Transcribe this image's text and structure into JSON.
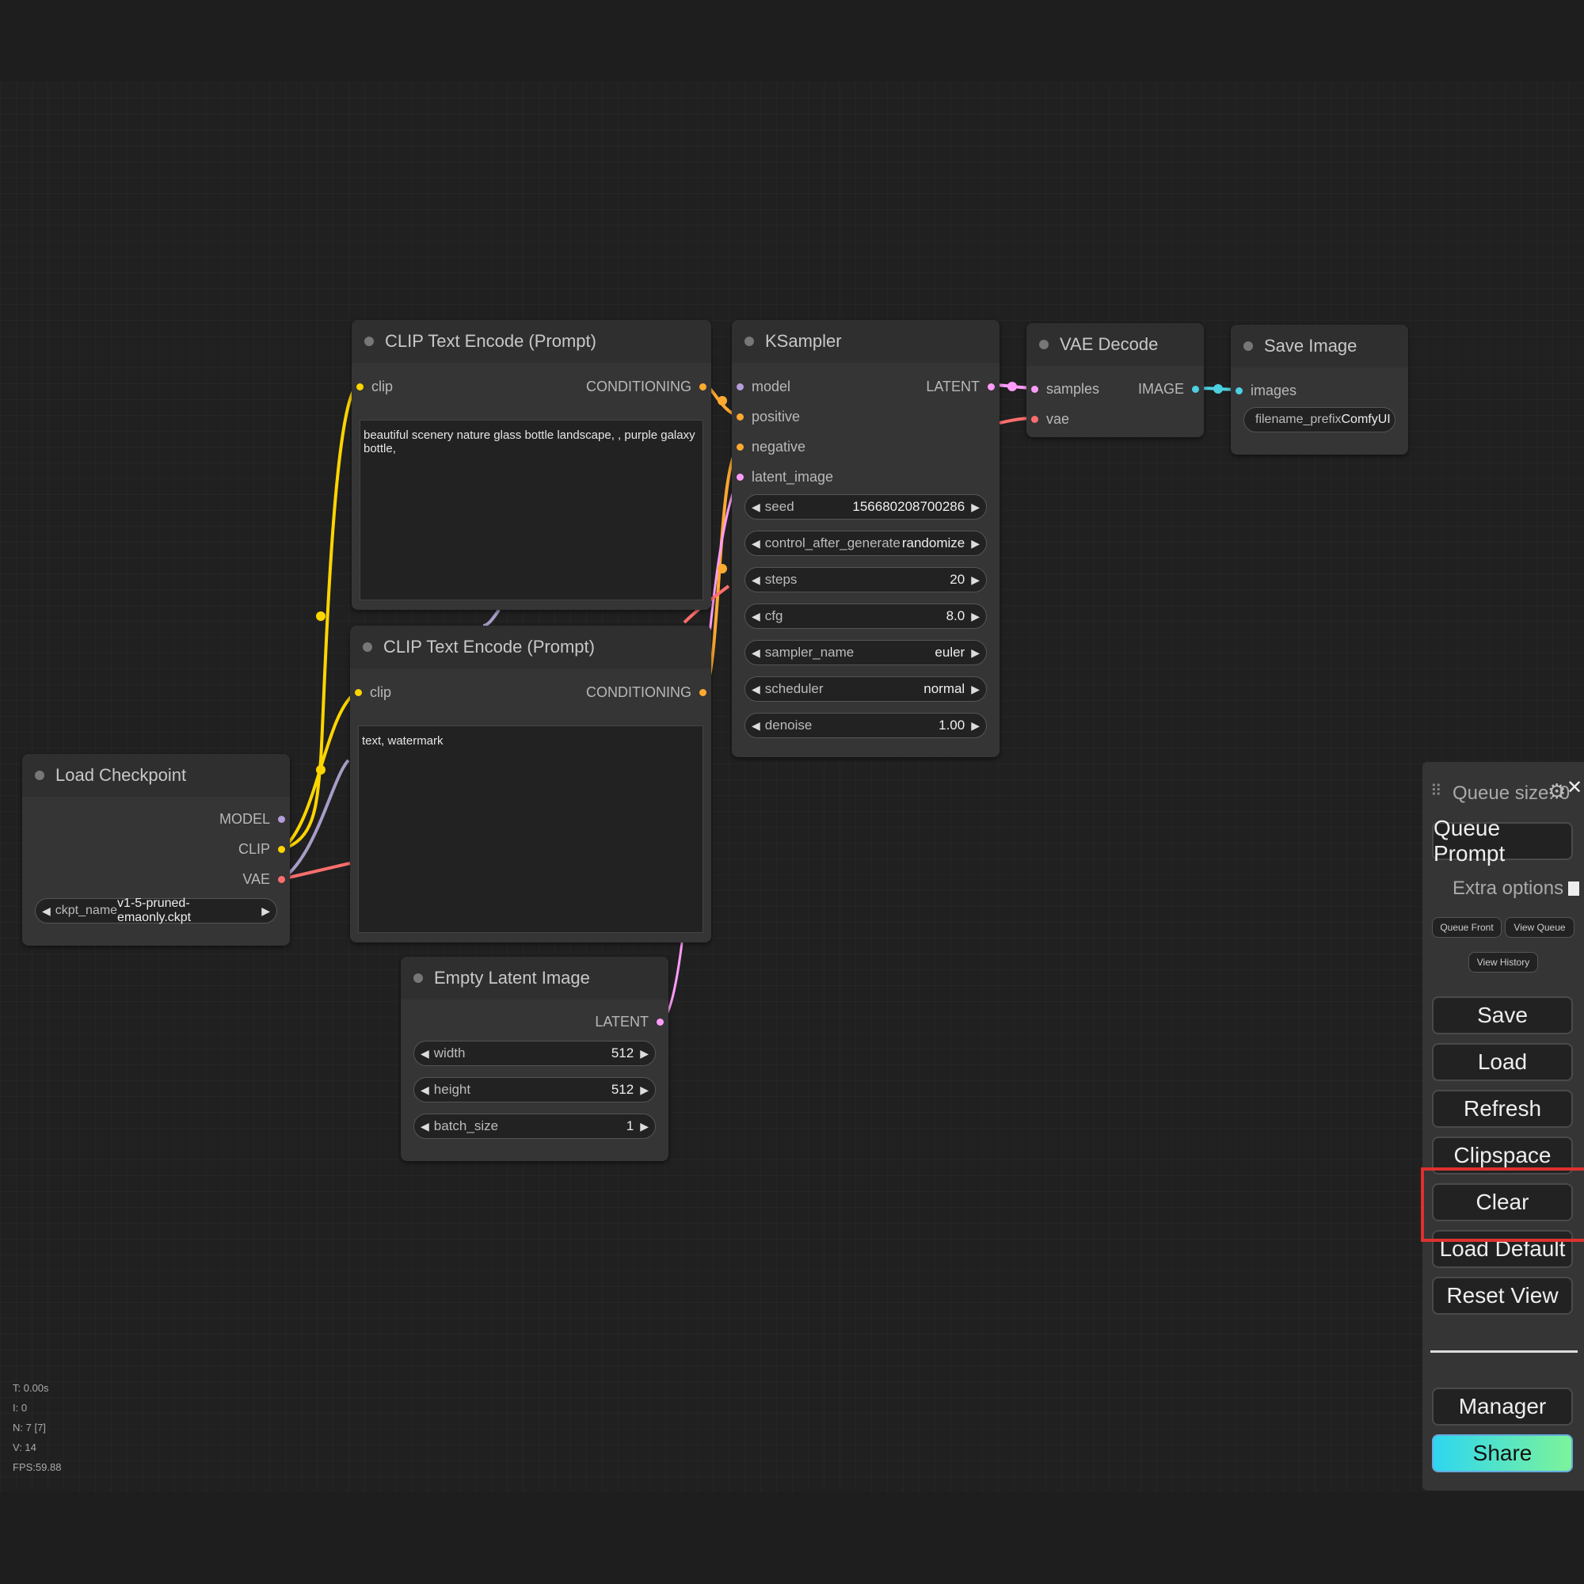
{
  "colors": {
    "model": "#b39ddb",
    "clip": "#ffd500",
    "conditioning": "#ffa931",
    "latent": "#ff9cf9",
    "vae": "#ff6e6e",
    "image": "#64b5f6",
    "share_gradient": [
      "#2ed6f0",
      "#7df39a"
    ],
    "highlight": "#e03030"
  },
  "nodes": {
    "clip_pos": {
      "title": "CLIP Text Encode (Prompt)",
      "in_clip": "clip",
      "out": "CONDITIONING",
      "text": "beautiful scenery nature glass bottle landscape, , purple galaxy bottle,"
    },
    "clip_neg": {
      "title": "CLIP Text Encode (Prompt)",
      "in_clip": "clip",
      "out": "CONDITIONING",
      "text": "text, watermark"
    },
    "ksampler": {
      "title": "KSampler",
      "inputs": [
        "model",
        "positive",
        "negative",
        "latent_image"
      ],
      "out": "LATENT",
      "widgets": [
        {
          "name": "seed",
          "value": "156680208700286"
        },
        {
          "name": "control_after_generate",
          "value": "randomize"
        },
        {
          "name": "steps",
          "value": "20"
        },
        {
          "name": "cfg",
          "value": "8.0"
        },
        {
          "name": "sampler_name",
          "value": "euler"
        },
        {
          "name": "scheduler",
          "value": "normal"
        },
        {
          "name": "denoise",
          "value": "1.00"
        }
      ]
    },
    "vae_decode": {
      "title": "VAE Decode",
      "in_samples": "samples",
      "in_vae": "vae",
      "out": "IMAGE"
    },
    "save_image": {
      "title": "Save Image",
      "in_images": "images",
      "widget": {
        "name": "filename_prefix",
        "value": "ComfyUI"
      }
    },
    "load_ckpt": {
      "title": "Load Checkpoint",
      "outputs": [
        "MODEL",
        "CLIP",
        "VAE"
      ],
      "widget": {
        "name": "ckpt_name",
        "value": "v1-5-pruned-emaonly.ckpt"
      }
    },
    "empty_latent": {
      "title": "Empty Latent Image",
      "out": "LATENT",
      "widgets": [
        {
          "name": "width",
          "value": "512"
        },
        {
          "name": "height",
          "value": "512"
        },
        {
          "name": "batch_size",
          "value": "1"
        }
      ]
    }
  },
  "stats": [
    "T: 0.00s",
    "I: 0",
    "N: 7 [7]",
    "V: 14",
    "FPS:59.88"
  ],
  "panel": {
    "queue_size": "Queue size: 0",
    "queue_prompt": "Queue Prompt",
    "extra_options": "Extra options",
    "queue_front": "Queue Front",
    "view_queue": "View Queue",
    "view_history": "View History",
    "save": "Save",
    "load": "Load",
    "refresh": "Refresh",
    "clipspace": "Clipspace",
    "clear": "Clear",
    "load_default": "Load Default",
    "reset_view": "Reset View",
    "manager": "Manager",
    "share": "Share"
  }
}
